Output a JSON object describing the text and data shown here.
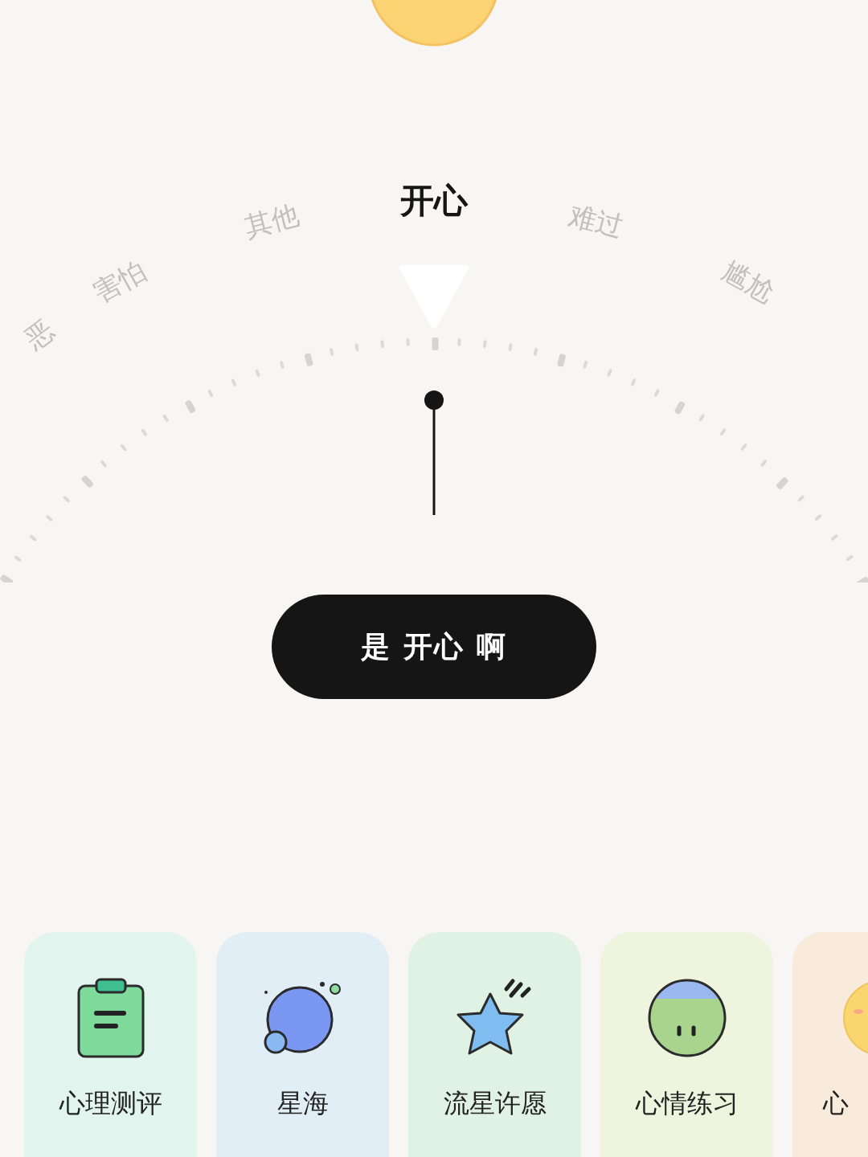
{
  "dial": {
    "options": [
      {
        "label": "恶",
        "selected": false
      },
      {
        "label": "害怕",
        "selected": false
      },
      {
        "label": "其他",
        "selected": false
      },
      {
        "label": "开心",
        "selected": true
      },
      {
        "label": "难过",
        "selected": false
      },
      {
        "label": "尴尬",
        "selected": false
      }
    ]
  },
  "confirm_button": {
    "label": "是 开心 啊"
  },
  "cards": [
    {
      "kind": "clipboard",
      "label": "心理测评",
      "color": "#e1f4ee"
    },
    {
      "kind": "planet",
      "label": "星海",
      "color": "#e1eef5"
    },
    {
      "kind": "star",
      "label": "流星许愿",
      "color": "#dff2e3"
    },
    {
      "kind": "face",
      "label": "心情练习",
      "color": "#eef4de"
    },
    {
      "kind": "sun",
      "label": "心",
      "color": "#f8ebdb"
    }
  ]
}
